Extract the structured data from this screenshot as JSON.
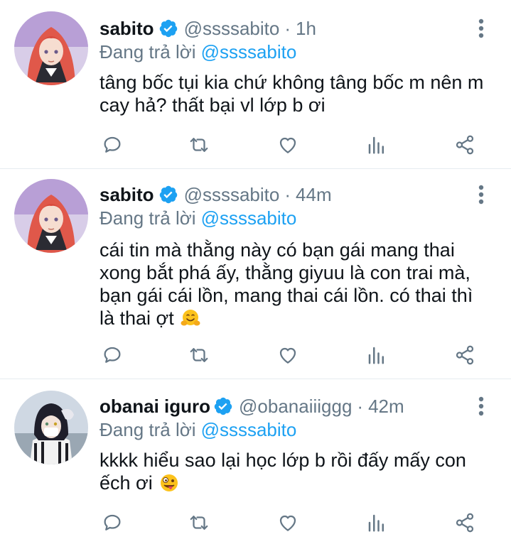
{
  "tweets": [
    {
      "name": "sabito",
      "handle": "@ssssabito",
      "separator": "·",
      "time": "1h",
      "replying_label": "Đang trả lời",
      "replying_to": "@ssssabito",
      "text": "tâng bốc tụi kia chứ không tâng bốc m nên m cay hả? thất bại vl lớp b ơi",
      "emoji": ""
    },
    {
      "name": "sabito",
      "handle": "@ssssabito",
      "separator": "·",
      "time": "44m",
      "replying_label": "Đang trả lời",
      "replying_to": "@ssssabito",
      "text": "cái tin mà thằng này có bạn gái mang thai xong bắt phá ấy, thằng giyuu là con trai mà, bạn gái cái lồn, mang thai cái lồn. có thai thì là thai ợt",
      "emoji": "hugging-face"
    },
    {
      "name": "obanai iguro",
      "handle": "@obanaiiiggg",
      "separator": "·",
      "time": "42m",
      "replying_label": "Đang trả lời",
      "replying_to": "@ssssabito",
      "text": "kkkk hiểu sao lại học lớp b rồi đấy mấy con ếch ơi",
      "emoji": "zany-face"
    }
  ],
  "colors": {
    "accent": "#1da1f2",
    "secondary_text": "#657786",
    "icon": "#657786",
    "divider": "#e6ecf0"
  },
  "icons": [
    "verified-badge-icon",
    "more-vertical-icon",
    "reply-icon",
    "retweet-icon",
    "like-icon",
    "analytics-icon",
    "share-icon"
  ]
}
